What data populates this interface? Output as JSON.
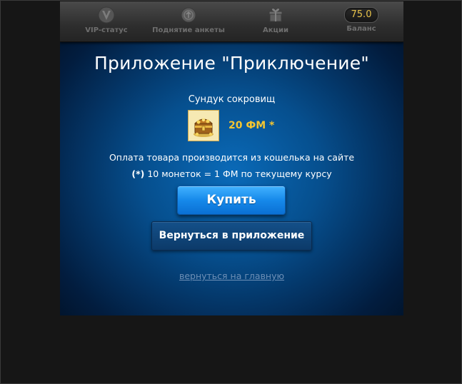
{
  "nav": {
    "items": [
      {
        "label": "VIP-статус",
        "icon": "vip-v-icon"
      },
      {
        "label": "Поднятие анкеты",
        "icon": "raise-coin-icon"
      },
      {
        "label": "Акции",
        "icon": "gift-icon"
      },
      {
        "label": "Баланс",
        "icon": "balance-badge"
      }
    ],
    "balance_value": "75.0"
  },
  "page": {
    "title": "Приложение \"Приключение\"",
    "product_name": "Сундук сокровищ",
    "product_icon": "treasure-chest-icon",
    "price": "20 ФМ *",
    "info_line1": "Оплата товара производится из кошелька на сайте",
    "info_star": "(*)",
    "info_line2": "10 монеток = 1 ФМ по текущему курсу",
    "buy_label": "Купить",
    "back_label": "Вернуться в приложение",
    "home_link": "вернуться на главную"
  },
  "colors": {
    "accent_gold": "#f3c531",
    "buy_button": "#1689ea",
    "background_blue": "#064f8e"
  }
}
